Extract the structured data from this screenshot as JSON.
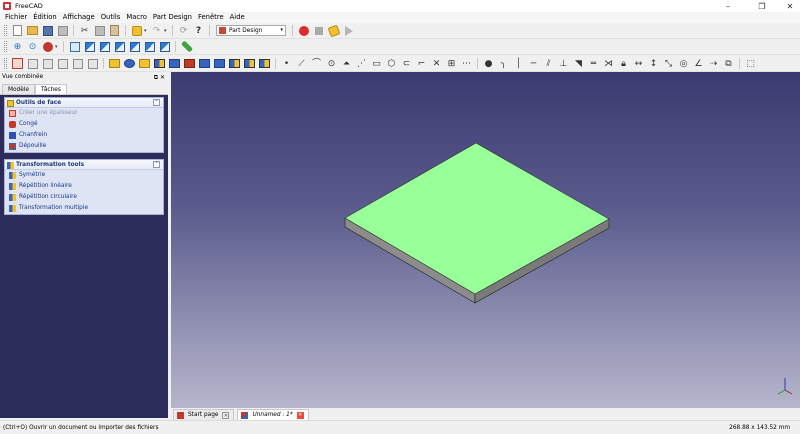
{
  "window": {
    "title": "FreeCAD",
    "minimize": "–",
    "maximize": "❒",
    "close": "✕"
  },
  "menu": [
    "Fichier",
    "Édition",
    "Affichage",
    "Outils",
    "Macro",
    "Part Design",
    "Fenêtre",
    "Aide"
  ],
  "toolbar": {
    "workbench": "Part Design"
  },
  "combo": {
    "title": "Vue combinée",
    "tabs": [
      "Modèle",
      "Tâches"
    ]
  },
  "task_boxes": [
    {
      "title": "Outils de face",
      "items": [
        "Créer une épaisseur",
        "Congé",
        "Chanfrein",
        "Dépouille"
      ]
    },
    {
      "title": "Transformation tools",
      "items": [
        "Symétrie",
        "Répétition linéaire",
        "Répétition circulaire",
        "Transformation multiple"
      ]
    }
  ],
  "doc_tabs": [
    {
      "label": "Start page"
    },
    {
      "label": "Unnamed : 1*"
    }
  ],
  "status": {
    "message": "(Ctrl+O) Ouvrir un document ou importer des fichiers",
    "dimensions": "268.88 x 143.52 mm"
  },
  "colors": {
    "plate_top": "#99ff99",
    "plate_side_front": "#8c8c8c",
    "plate_side_right": "#7a7a7a"
  }
}
